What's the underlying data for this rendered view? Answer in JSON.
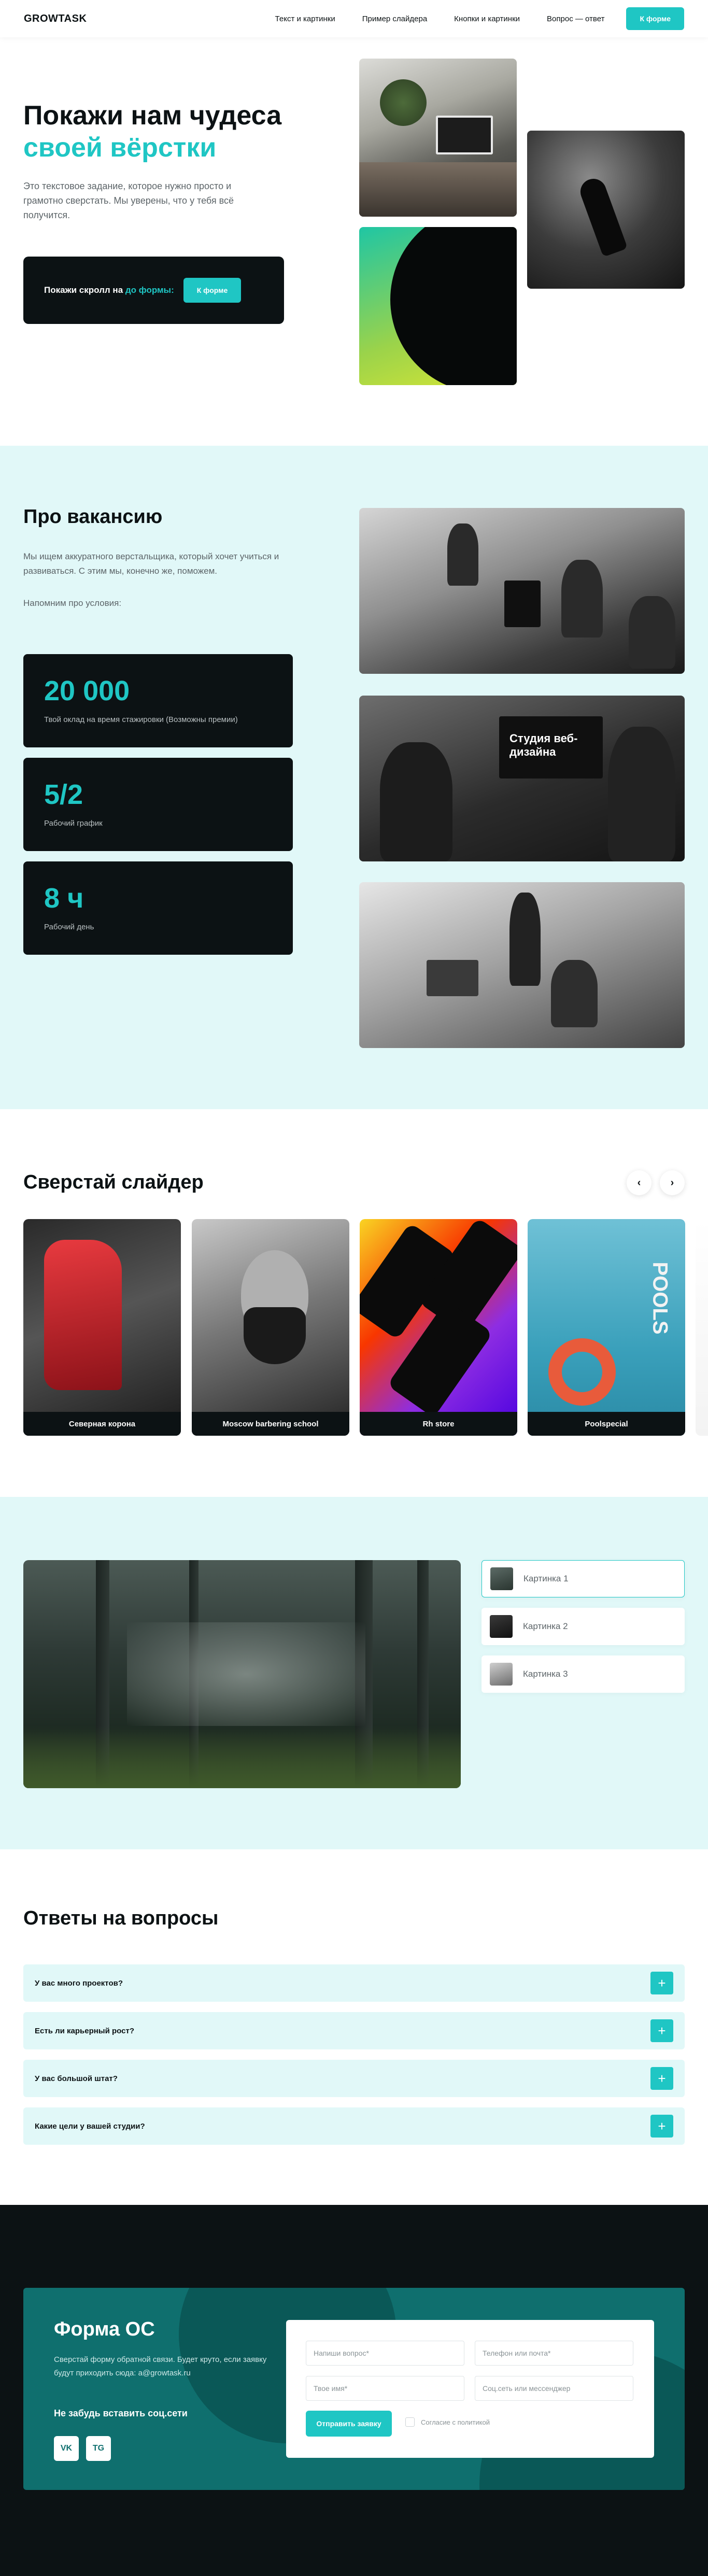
{
  "header": {
    "logo": "GROWTASK",
    "nav": [
      "Текст и картинки",
      "Пример слайдера",
      "Кнопки и картинки",
      "Вопрос — ответ"
    ],
    "cta": "К форме"
  },
  "hero": {
    "title_line1": "Покажи нам чудеса",
    "title_line2": "своей вёрстки",
    "subtitle": "Это текстовое задание, которое нужно просто и грамотно сверстать. Мы уверены, что у тебя всё получится.",
    "scroll_text": "Покажи скролл на",
    "scroll_accent": "до формы:",
    "scroll_button": "К форме"
  },
  "vacancy": {
    "title": "Про вакансию",
    "text1": "Мы ищем аккуратного верстальщика, который хочет учиться и развиваться. С этим мы, конечно же, поможем.",
    "text2": "Напомним про условия:",
    "stats": [
      {
        "value": "20 000",
        "label": "Твой оклад на время стажировки (Возможны премии)"
      },
      {
        "value": "5/2",
        "label": "Рабочий график"
      },
      {
        "value": "8 ч",
        "label": "Рабочий день"
      }
    ],
    "photo_caption": "Студия веб-дизайна"
  },
  "slider": {
    "title": "Сверстай слайдер",
    "prev": "‹",
    "next": "›",
    "cards": [
      "Северная корона",
      "Moscow barbering school",
      "Rh store",
      "Poolspecial"
    ],
    "card4_text": "POOLS"
  },
  "gallery": {
    "items": [
      "Картинка 1",
      "Картинка 2",
      "Картинка 3"
    ]
  },
  "faq": {
    "title": "Ответы на вопросы",
    "items": [
      "У вас много проектов?",
      "Есть ли карьерный рост?",
      "У вас большой штат?",
      "Какие цели у вашей студии?"
    ],
    "plus": "+"
  },
  "form": {
    "title": "Форма ОС",
    "description": "Сверстай форму обратной связи. Будет круто, если заявку будут приходить сюда: a@growtask.ru",
    "social_title": "Не забудь вставить соц.сети",
    "social": [
      "VK",
      "TG"
    ],
    "placeholders": {
      "question": "Напиши вопрос*",
      "contact": "Телефон или почта*",
      "name": "Твое имя*",
      "messenger": "Соц.сеть или мессенджер"
    },
    "submit": "Отправить заявку",
    "consent": "Согласие с политикой"
  },
  "colors": {
    "accent": "#1fc6c4",
    "dark": "#0c1214",
    "mint": "#e1f8f8",
    "form_bg": "#0f6f6e"
  }
}
